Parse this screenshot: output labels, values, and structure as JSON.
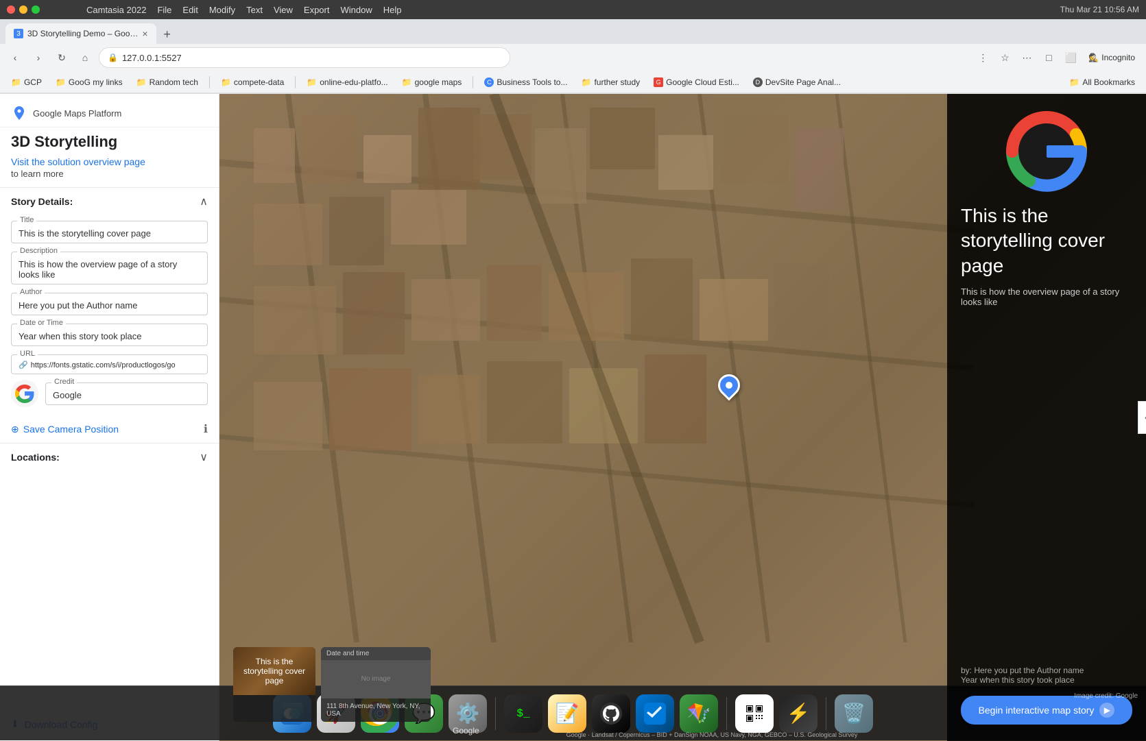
{
  "app": {
    "name": "Camtasia 2022",
    "menus": [
      "Camtasia 2022",
      "File",
      "Edit",
      "Modify",
      "Text",
      "View",
      "Export",
      "Window",
      "Help"
    ],
    "time": "Thu Mar 21  10:56 AM"
  },
  "browser": {
    "tab_title": "3D Storytelling Demo – Goo…",
    "url": "127.0.0.1:5527",
    "bookmarks": [
      {
        "label": "GCP",
        "has_icon": false
      },
      {
        "label": "GooG my links",
        "has_icon": false
      },
      {
        "label": "Random tech",
        "has_icon": false
      },
      {
        "label": "compete-data",
        "has_icon": false
      },
      {
        "label": "online-edu-platfo...",
        "has_icon": false
      },
      {
        "label": "google maps",
        "has_icon": false
      },
      {
        "label": "Business Tools to...",
        "has_icon": true
      },
      {
        "label": "further study",
        "has_icon": false
      },
      {
        "label": "Google Cloud Esti...",
        "has_icon": true
      },
      {
        "label": "DevSite Page Anal...",
        "has_icon": false
      },
      {
        "label": "All Bookmarks",
        "has_icon": false
      }
    ]
  },
  "sidebar": {
    "brand": "Google Maps Platform",
    "title": "3D Storytelling",
    "link_text": "Visit the solution overview page",
    "link_sub": "to learn more",
    "story_details_label": "Story Details:",
    "fields": {
      "title_label": "Title",
      "title_value": "This is the storytelling cover page",
      "description_label": "Description",
      "description_value": "This is how the overview page of a story looks like",
      "author_label": "Author",
      "author_value": "Here you put the Author name",
      "date_label": "Date or Time",
      "date_value": "Year when this story took place",
      "url_label": "URL",
      "url_value": "https://fonts.gstatic.com/s/i/productlogos/go",
      "credit_label": "Credit",
      "credit_value": "Google"
    },
    "save_camera_label": "Save Camera Position",
    "locations_label": "Locations:",
    "download_label": "Download Config"
  },
  "cover_overlay": {
    "title": "This is the storytelling cover page",
    "description": "This is how the overview page of a story looks like",
    "credit_by": "by: Here you put the Author name",
    "credit_date": "Year when this story took place",
    "begin_btn": "Begin interactive map story",
    "image_credit": "Image credit: Google"
  },
  "thumbnails": [
    {
      "type": "cover",
      "text": "This is the storytelling cover page"
    },
    {
      "type": "date",
      "header": "Date and time",
      "image_label": "No image",
      "address": "111 8th Avenue, New York, NY, USA"
    }
  ],
  "attribution": "Google · Landsat / Copernicus – BID + DanSign NOAA, US Navy, NGA, GEBCO – U.S. Geological Survey",
  "dock_icons": [
    "🔍",
    "🚀",
    "🌐",
    "💬",
    "⚙️",
    "💻",
    "📝",
    "🐙",
    "🖥️",
    "🪁",
    "📱",
    "⚡",
    "🗑️"
  ]
}
